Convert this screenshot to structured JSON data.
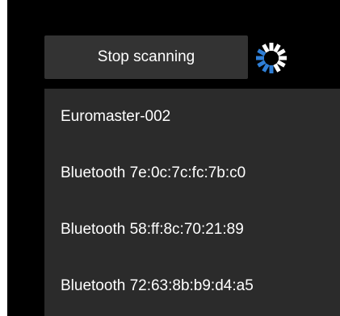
{
  "scan": {
    "button_label": "Stop scanning",
    "busy_icon": "spinner-icon"
  },
  "devices": [
    {
      "label": "Euromaster-002"
    },
    {
      "label": "Bluetooth 7e:0c:7c:fc:7b:c0"
    },
    {
      "label": "Bluetooth 58:ff:8c:70:21:89"
    },
    {
      "label": "Bluetooth 72:63:8b:b9:d4:a5"
    }
  ],
  "colors": {
    "background": "#000000",
    "button_bg": "#333333",
    "list_bg": "#2b2b2b",
    "text": "#ffffff",
    "spinner_dark": "#2f7fd6",
    "spinner_light": "#ffffff"
  }
}
